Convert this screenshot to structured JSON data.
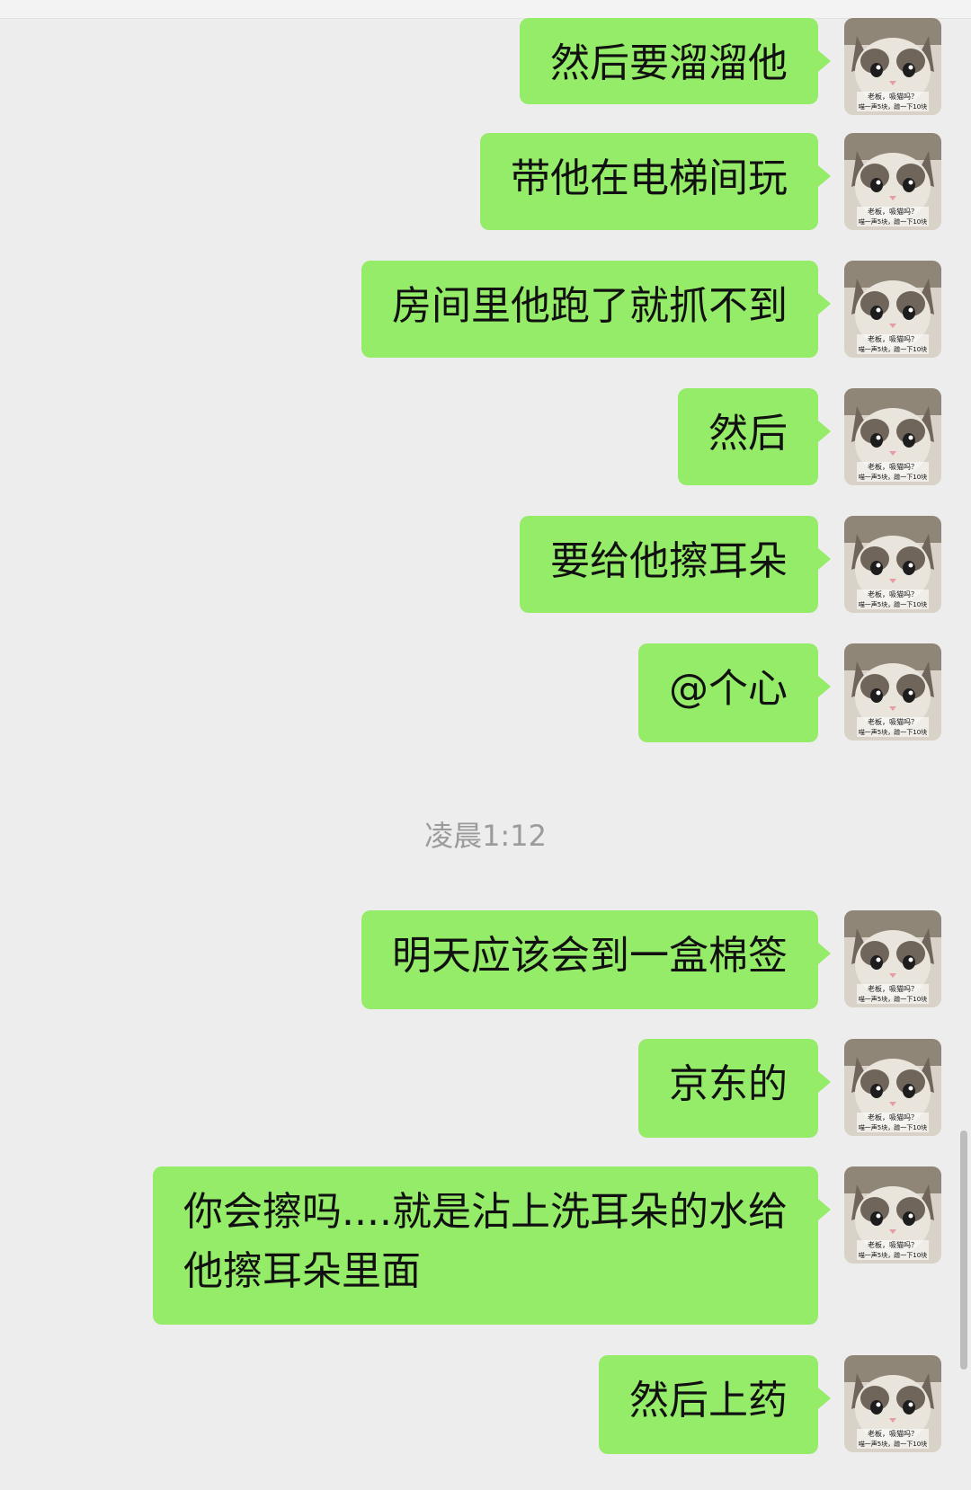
{
  "messages": [
    {
      "text": "然后要溜溜他"
    },
    {
      "text": "带他在电梯间玩"
    },
    {
      "text": "房间里他跑了就抓不到"
    },
    {
      "text": "然后"
    },
    {
      "text": "要给他擦耳朵"
    },
    {
      "text": "@个心"
    },
    {
      "text": "明天应该会到一盒棉签"
    },
    {
      "text": "京东的"
    },
    {
      "text": "你会擦吗....就是沾上洗耳朵的水给他擦耳朵里面"
    },
    {
      "text": "然后上药"
    }
  ],
  "timestamp": "凌晨1:12",
  "avatar": {
    "icon": "cat-avatar-icon",
    "caption_line1": "老板，吸猫吗？",
    "caption_line2": "喵一声5块，蹭一下10块"
  },
  "colors": {
    "bubble": "#95ec69",
    "background": "#ededed",
    "timestamp": "#9b9b9b"
  }
}
